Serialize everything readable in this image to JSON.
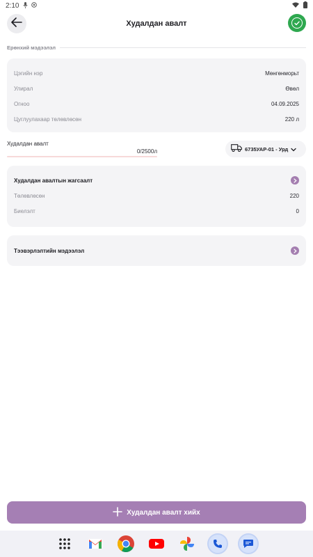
{
  "status_bar": {
    "time": "2:10"
  },
  "app_bar": {
    "title": "Худалдан авалт",
    "back_icon": "arrow-left-icon",
    "confirm_icon": "check-circle-icon",
    "confirm_color": "#2ea84f"
  },
  "general_info": {
    "heading": "Ерөнхий мэдээлэл",
    "rows": [
      {
        "label": "Цэгийн нэр",
        "value": "Мөнгөнморьт"
      },
      {
        "label": "Улирал",
        "value": "Өвөл"
      },
      {
        "label": "Огноо",
        "value": "04.09.2025"
      },
      {
        "label": "Цуглуулахаар төлөвлөсөн",
        "value": "220 л"
      }
    ]
  },
  "sales": {
    "label": "Худалдан авалт",
    "count": "0/2500л",
    "progress_fraction": 0,
    "track_color": "#f7d9d9"
  },
  "vehicle_select": {
    "icon": "truck-icon",
    "selected": "6735УАР-01 - Урд",
    "chevron_icon": "chevron-down-icon"
  },
  "sales_list": {
    "title": "Худалдан авалтын жагсаалт",
    "rows": [
      {
        "label": "Төлөвлөсөн",
        "value": "220"
      },
      {
        "label": "Биелэлт",
        "value": "0"
      }
    ]
  },
  "transport_info": {
    "title": "Тээвэрлэлтийн мэдээлэл"
  },
  "primary_action": {
    "label": "Худалдан авалт хийх",
    "icon": "plus-icon",
    "color": "#a57fb4"
  },
  "dock": {
    "apps": [
      "app-drawer-icon",
      "gmail-icon",
      "chrome-icon",
      "youtube-icon",
      "photos-icon",
      "phone-icon",
      "messages-icon"
    ]
  }
}
